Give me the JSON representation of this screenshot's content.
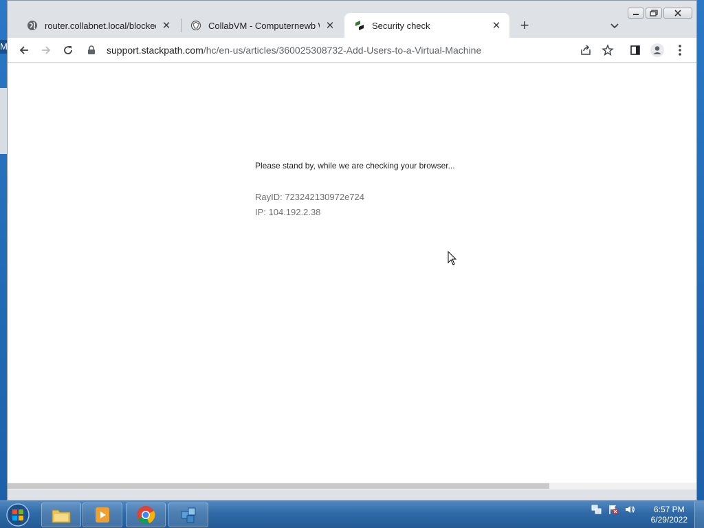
{
  "desktop": {
    "edge_letter": "M"
  },
  "browser": {
    "tabs": [
      {
        "title": "router.collabnet.local/blocked.php",
        "favicon": "globe-icon",
        "active": false
      },
      {
        "title": "CollabVM - Computernewb Wiki",
        "favicon": "wiki-icon",
        "active": false
      },
      {
        "title": "Security check",
        "favicon": "stackpath-icon",
        "active": true
      }
    ],
    "url": {
      "host": "support.stackpath.com",
      "path": "/hc/en-us/articles/360025308732-Add-Users-to-a-Virtual-Machine"
    }
  },
  "page": {
    "message": "Please stand by, while we are checking your browser...",
    "ray_id": "RayID: 723242130972e724",
    "ip": "IP: 104.192.2.38"
  },
  "taskbar": {
    "time": "6:57 PM",
    "date": "6/29/2022"
  },
  "colors": {
    "taskbar": "#2f6aa6",
    "tab_strip": "#dee1e6",
    "accent_stackpath": "#2e7d32"
  }
}
